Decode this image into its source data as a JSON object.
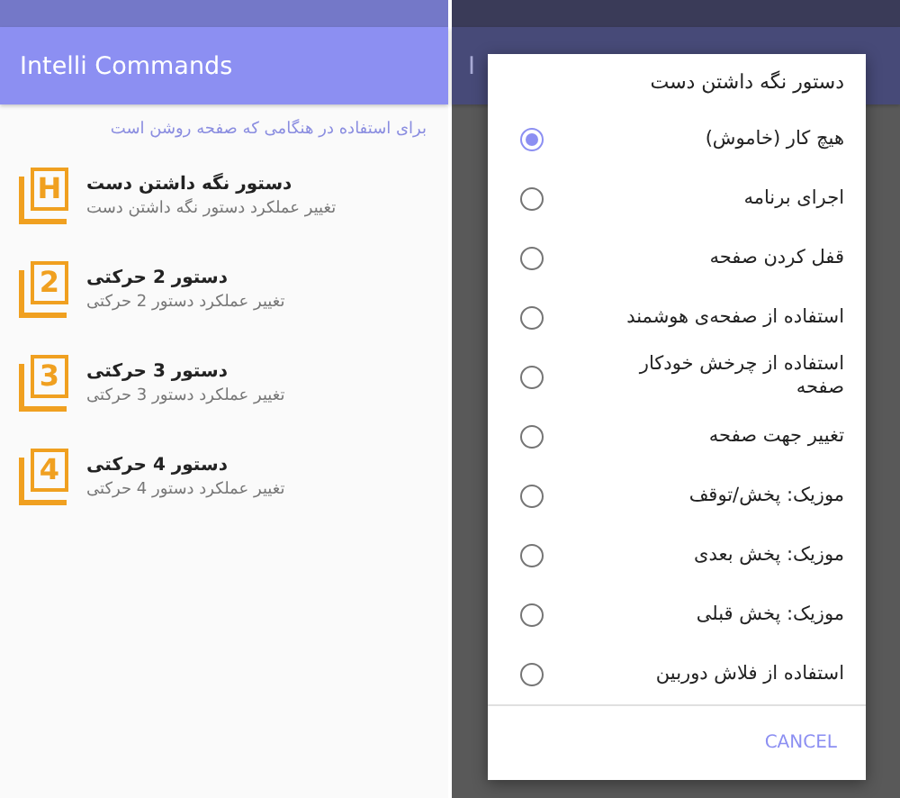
{
  "app_bar": {
    "title": "Intelli Commands"
  },
  "hint": "برای استفاده در هنگامی که صفحه روشن است",
  "commands": [
    {
      "badge": "H",
      "title": "دستور نگه داشتن دست",
      "subtitle": "تغییر عملکرد دستور نگه داشتن دست"
    },
    {
      "badge": "2",
      "title": "دستور 2 حرکتی",
      "subtitle": "تغییر عملکرد دستور 2 حرکتی"
    },
    {
      "badge": "3",
      "title": "دستور 3 حرکتی",
      "subtitle": "تغییر عملکرد دستور 3 حرکتی"
    },
    {
      "badge": "4",
      "title": "دستور 4 حرکتی",
      "subtitle": "تغییر عملکرد دستور 4 حرکتی"
    }
  ],
  "background_screen": {
    "title_fragment": "I"
  },
  "dialog": {
    "title": "دستور نگه داشتن دست",
    "options": [
      {
        "label": "هیچ کار (خاموش)",
        "selected": true
      },
      {
        "label": "اجرای برنامه",
        "selected": false
      },
      {
        "label": "قفل کردن صفحه",
        "selected": false
      },
      {
        "label": "استفاده از صفحه‌ی هوشمند",
        "selected": false
      },
      {
        "label": "استفاده از چرخش خودکار صفحه",
        "selected": false
      },
      {
        "label": "تغییر جهت صفحه",
        "selected": false
      },
      {
        "label": "موزیک: پخش/توقف",
        "selected": false
      },
      {
        "label": "موزیک: پخش بعدی",
        "selected": false
      },
      {
        "label": "موزیک: پخش قبلی",
        "selected": false
      },
      {
        "label": "استفاده از فلاش دوربین",
        "selected": false
      }
    ],
    "button": "CANCEL"
  }
}
